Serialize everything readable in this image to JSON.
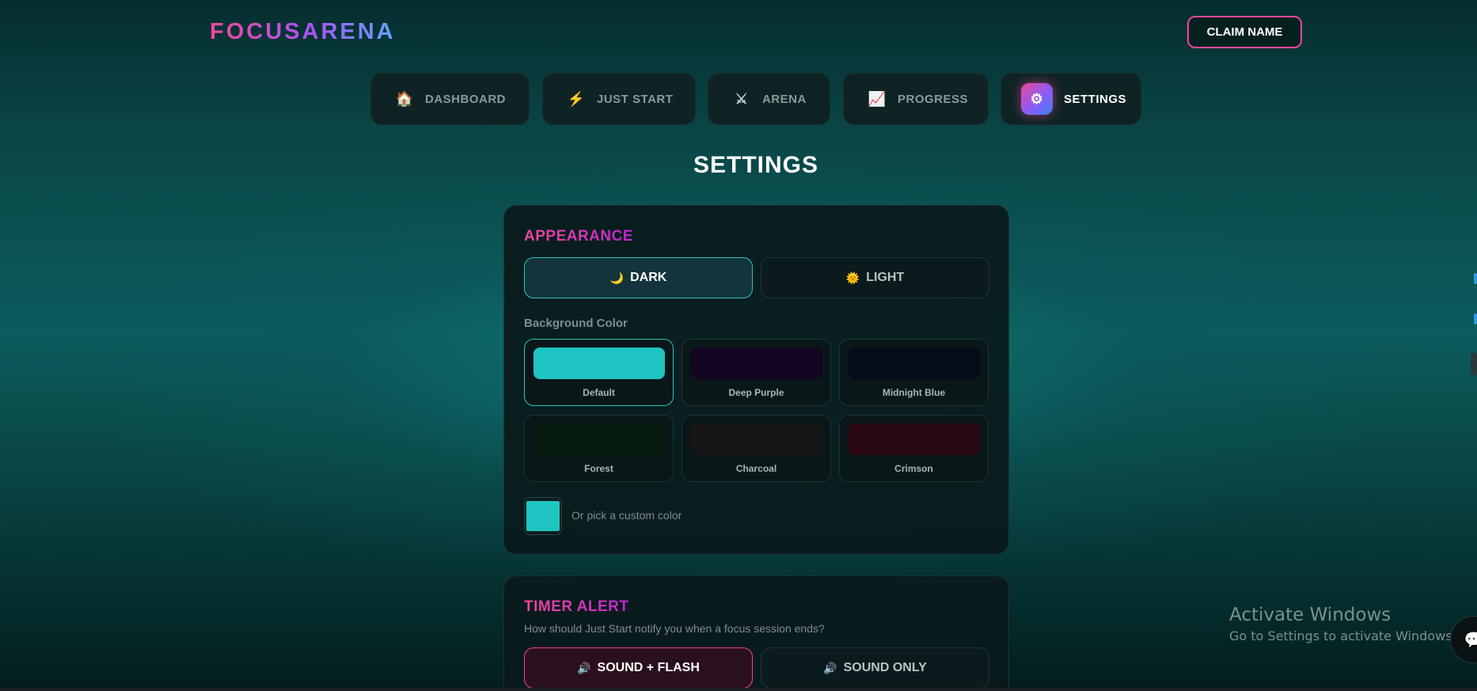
{
  "header": {
    "logo": "FOCUSARENA",
    "claim_button": "CLAIM NAME"
  },
  "nav": {
    "items": [
      {
        "label": "DASHBOARD",
        "icon": "house-icon",
        "glyph": "🏠"
      },
      {
        "label": "JUST START",
        "icon": "lightning-icon",
        "glyph": "⚡"
      },
      {
        "label": "ARENA",
        "icon": "crossed-swords-icon",
        "glyph": "⚔"
      },
      {
        "label": "PROGRESS",
        "icon": "chart-increasing-icon",
        "glyph": "📈"
      },
      {
        "label": "SETTINGS",
        "icon": "gear-icon",
        "glyph": "⚙",
        "active": true
      }
    ]
  },
  "page_title": "SETTINGS",
  "appearance": {
    "title": "APPEARANCE",
    "themes": [
      {
        "label": "DARK",
        "icon": "crescent-moon-icon",
        "glyph": "🌙",
        "selected": true
      },
      {
        "label": "LIGHT",
        "icon": "sun-icon",
        "glyph": "🌞",
        "selected": false
      }
    ],
    "bg_label": "Background Color",
    "swatches": [
      {
        "name": "Default",
        "color": "#1fc5c2",
        "selected": true
      },
      {
        "name": "Deep Purple",
        "color": "#140522"
      },
      {
        "name": "Midnight Blue",
        "color": "#060b1a"
      },
      {
        "name": "Forest",
        "color": "#061a10"
      },
      {
        "name": "Charcoal",
        "color": "#161618"
      },
      {
        "name": "Crimson",
        "color": "#2a0812"
      }
    ],
    "custom_color_label": "Or pick a custom color",
    "custom_color_value": "#1fc5c2"
  },
  "timer_alert": {
    "title": "TIMER ALERT",
    "description": "How should Just Start notify you when a focus session ends?",
    "options": [
      {
        "label": "SOUND + FLASH",
        "icon": "speaker-icon",
        "glyph": "🔊",
        "selected": true
      },
      {
        "label": "SOUND ONLY",
        "icon": "speaker-icon",
        "glyph": "🔊",
        "selected": false
      }
    ]
  },
  "os_overlay": {
    "line1": "Activate Windows",
    "line2": "Go to Settings to activate Windows."
  },
  "colors": {
    "accent_pink": "#ec4899",
    "accent_teal": "#2cc5c0",
    "background": "#0c5c5c"
  }
}
